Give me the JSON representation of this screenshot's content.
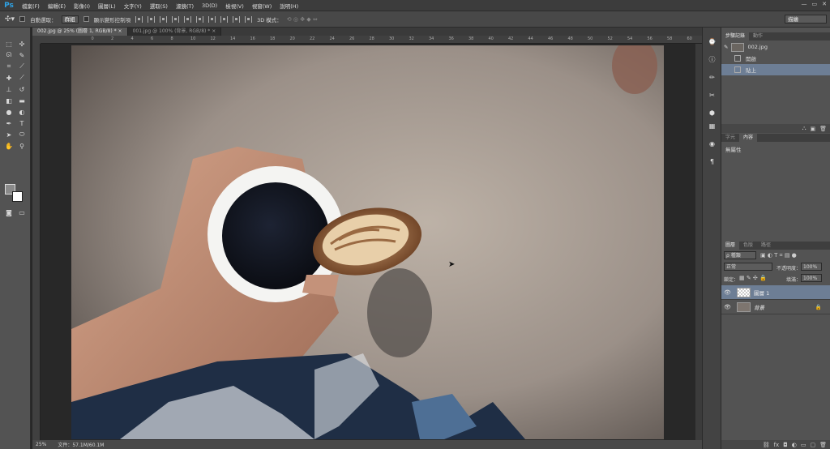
{
  "app": {
    "logo": "Ps"
  },
  "menu": [
    "檔案(F)",
    "編輯(E)",
    "影像(I)",
    "圖層(L)",
    "文字(Y)",
    "選取(S)",
    "濾鏡(T)",
    "3D(D)",
    "檢視(V)",
    "視窗(W)",
    "說明(H)"
  ],
  "window_controls": [
    "—",
    "▭",
    "✕"
  ],
  "options": {
    "auto_select_label": "自動選取：",
    "auto_select_value": "群組",
    "transform_label": "顯示變形控制項",
    "mode3d_label": "3D 模式：",
    "workspace": "描繪"
  },
  "tabs": [
    {
      "label": "002.jpg @ 25% (圖層 1, RGB/8) *",
      "close": "×"
    },
    {
      "label": "001.jpg @ 100% (背景, RGB/8) *",
      "close": "×"
    }
  ],
  "ruler_top_ticks": [
    "",
    "0",
    "2",
    "4",
    "6",
    "8",
    "10",
    "12",
    "14",
    "16",
    "18",
    "20",
    "22",
    "24",
    "26",
    "28",
    "30",
    "32",
    "34",
    "36",
    "38",
    "40",
    "42",
    "44",
    "46",
    "48",
    "50",
    "52",
    "54",
    "56",
    "58",
    "60"
  ],
  "status": {
    "zoom": "25%",
    "doc": "文件：57.1M/60.1M"
  },
  "history_panel": {
    "tabs": [
      "步驟記錄",
      "動作"
    ],
    "snapshot": "002.jpg",
    "items": [
      {
        "label": "開啟",
        "selected": false
      },
      {
        "label": "貼上",
        "selected": true
      }
    ]
  },
  "char_panel": {
    "tabs": [
      "字元",
      "內容"
    ],
    "text": "無屬性"
  },
  "layers_panel": {
    "tabs": [
      "圖層",
      "色版",
      "路徑"
    ],
    "kind": "ρ 種類",
    "blend_mode": "正常",
    "opacity_label": "不透明度：",
    "opacity_value": "100%",
    "lock_label": "鎖定：",
    "fill_label": "填滿：",
    "fill_value": "100%",
    "layers": [
      {
        "name": "圖層 1",
        "selected": true,
        "locked": false
      },
      {
        "name": "背景",
        "selected": false,
        "locked": true
      }
    ]
  },
  "colors": {
    "accent": "#2fa3e6",
    "selection": "#6d7e95",
    "foreground": "#8a8a8a",
    "background": "#ffffff"
  }
}
